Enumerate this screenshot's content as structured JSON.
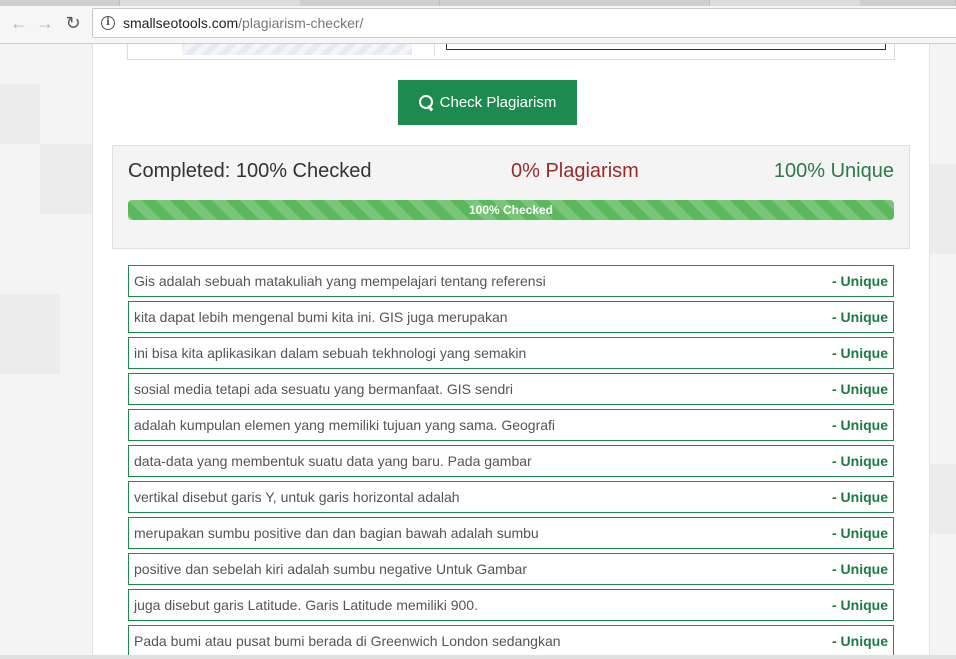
{
  "browser": {
    "url_host": "smallseotools.com",
    "url_path": "/plagiarism-checker/"
  },
  "check_button": {
    "label": "Check Plagiarism",
    "icon": "search-icon"
  },
  "summary": {
    "completed": "Completed: 100% Checked",
    "plagiarism": "0% Plagiarism",
    "unique": "100% Unique",
    "progress_label": "100% Checked",
    "progress_percent": 100
  },
  "results": [
    {
      "text": "Gis adalah sebuah matakuliah yang mempelajari tentang referensi",
      "status": "- Unique"
    },
    {
      "text": "kita dapat lebih mengenal bumi kita ini. GIS juga merupakan",
      "status": "- Unique"
    },
    {
      "text": "ini bisa kita aplikasikan dalam sebuah tekhnologi yang semakin",
      "status": "- Unique"
    },
    {
      "text": "sosial media tetapi ada sesuatu yang bermanfaat. GIS sendri",
      "status": "- Unique"
    },
    {
      "text": "adalah kumpulan elemen yang memiliki tujuan yang sama. Geografi",
      "status": "- Unique"
    },
    {
      "text": "data-data yang membentuk suatu data yang baru. Pada gambar",
      "status": "- Unique"
    },
    {
      "text": "vertikal disebut garis Y, untuk garis horizontal adalah",
      "status": "- Unique"
    },
    {
      "text": "merupakan sumbu positive dan dan bagian bawah adalah sumbu",
      "status": "- Unique"
    },
    {
      "text": "positive dan sebelah kiri adalah sumbu negative Untuk Gambar",
      "status": "- Unique"
    },
    {
      "text": "juga disebut garis Latitude. Garis Latitude memiliki 900.",
      "status": "- Unique"
    },
    {
      "text": "Pada bumi atau pusat bumi berada di Greenwich London sedangkan",
      "status": "- Unique"
    }
  ],
  "colors": {
    "brand_green": "#1d8a4e",
    "plagiarism_red": "#9b2a2a",
    "unique_green": "#2b7a48",
    "progress_green": "#5cb85c"
  }
}
